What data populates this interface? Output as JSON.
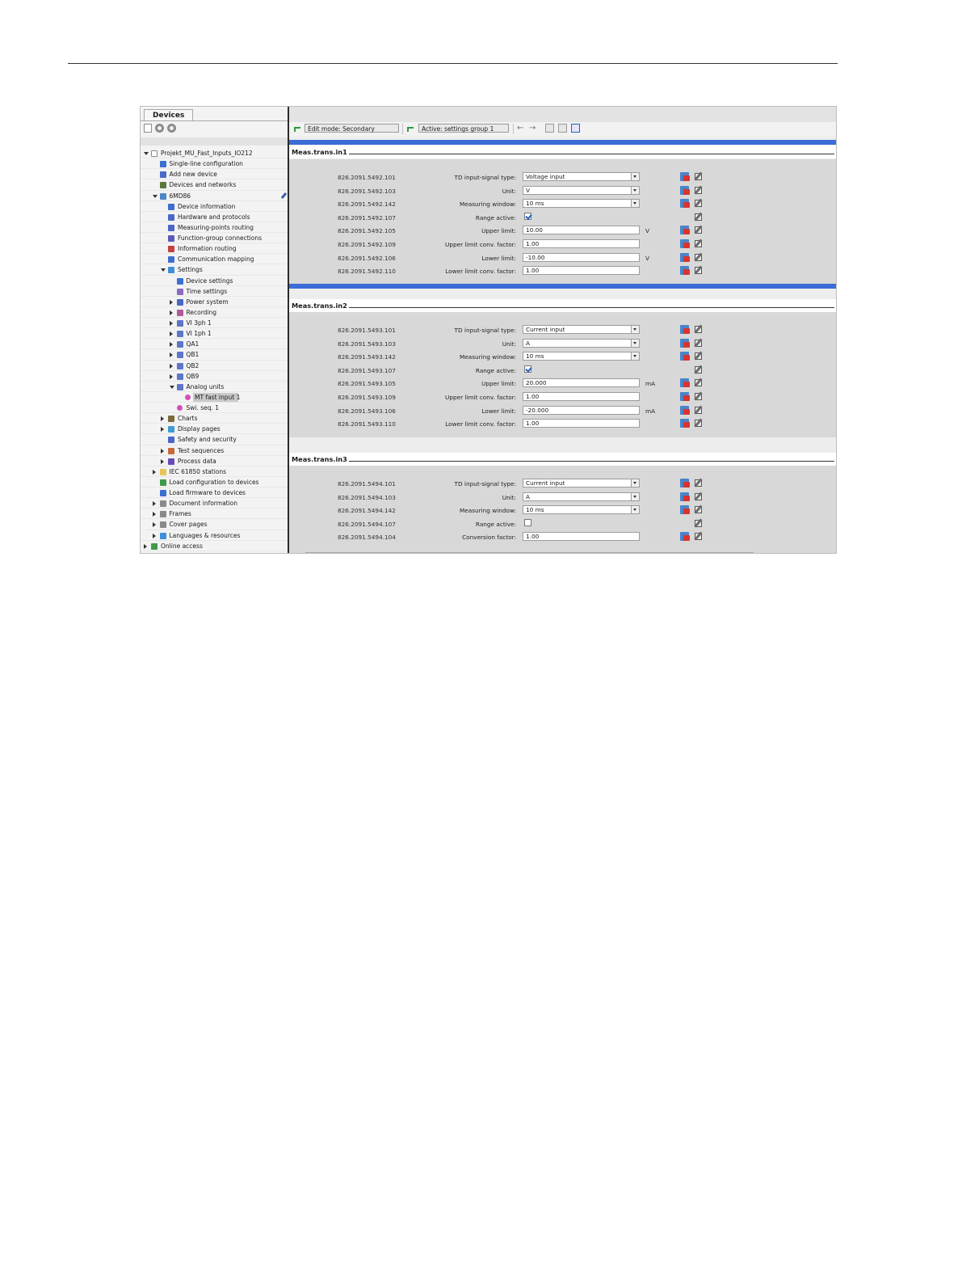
{
  "panel": {
    "tab_label": "Devices"
  },
  "tree": [
    {
      "label": "Projekt_MU_Fast_Inputs_IO212",
      "level": 0,
      "toggle": "open",
      "icon": "project-icon",
      "color": "#ffffff"
    },
    {
      "label": "Single-line configuration",
      "level": 1,
      "toggle": "",
      "icon": "single-line-icon",
      "color": "#3c6fd1"
    },
    {
      "label": "Add new device",
      "level": 1,
      "toggle": "",
      "icon": "add-device-icon",
      "color": "#4b67c7"
    },
    {
      "label": "Devices and networks",
      "level": 1,
      "toggle": "",
      "icon": "network-icon",
      "color": "#5a7a3a"
    },
    {
      "label": "6MD86",
      "level": 1,
      "toggle": "open",
      "icon": "device-icon",
      "color": "#4d86c6",
      "pin": true
    },
    {
      "label": "Device information",
      "level": 2,
      "toggle": "",
      "icon": "info-icon",
      "color": "#3c6fd1"
    },
    {
      "label": "Hardware and protocols",
      "level": 2,
      "toggle": "",
      "icon": "hardware-icon",
      "color": "#4b67c7"
    },
    {
      "label": "Measuring-points routing",
      "level": 2,
      "toggle": "",
      "icon": "routing-icon",
      "color": "#4b67c7"
    },
    {
      "label": "Function-group connections",
      "level": 2,
      "toggle": "",
      "icon": "connection-icon",
      "color": "#5a5ab8"
    },
    {
      "label": "Information routing",
      "level": 2,
      "toggle": "",
      "icon": "matrix-icon",
      "color": "#c74040"
    },
    {
      "label": "Communication mapping",
      "level": 2,
      "toggle": "",
      "icon": "mapping-icon",
      "color": "#3c6fd1"
    },
    {
      "label": "Settings",
      "level": 2,
      "toggle": "open",
      "icon": "settings-icon",
      "color": "#3f8fd6"
    },
    {
      "label": "Device settings",
      "level": 3,
      "toggle": "",
      "icon": "device-settings-icon",
      "color": "#3c6fd1"
    },
    {
      "label": "Time settings",
      "level": 3,
      "toggle": "",
      "icon": "time-settings-icon",
      "color": "#8a6ac4"
    },
    {
      "label": "Power system",
      "level": 3,
      "toggle": "closed",
      "icon": "power-system-icon",
      "color": "#4b67c7"
    },
    {
      "label": "Recording",
      "level": 3,
      "toggle": "closed",
      "icon": "recording-icon",
      "color": "#b05a9a"
    },
    {
      "label": "VI 3ph 1",
      "level": 3,
      "toggle": "closed",
      "icon": "function-group-icon",
      "color": "#5d76c9"
    },
    {
      "label": "VI 1ph 1",
      "level": 3,
      "toggle": "closed",
      "icon": "function-group-icon",
      "color": "#5d76c9"
    },
    {
      "label": "QA1",
      "level": 3,
      "toggle": "closed",
      "icon": "function-group-icon",
      "color": "#5d76c9"
    },
    {
      "label": "QB1",
      "level": 3,
      "toggle": "closed",
      "icon": "function-group-icon",
      "color": "#5d76c9"
    },
    {
      "label": "QB2",
      "level": 3,
      "toggle": "closed",
      "icon": "function-group-icon",
      "color": "#5d76c9"
    },
    {
      "label": "QB9",
      "level": 3,
      "toggle": "closed",
      "icon": "function-group-icon",
      "color": "#5d76c9"
    },
    {
      "label": "Analog units",
      "level": 3,
      "toggle": "open",
      "icon": "function-group-icon",
      "color": "#5d76c9"
    },
    {
      "label": "MT fast input 1",
      "level": 4,
      "toggle": "",
      "icon": "function-icon",
      "color": "#d44fb8",
      "selected": true
    },
    {
      "label": "Swi. seq. 1",
      "level": 3,
      "toggle": "",
      "icon": "function-icon",
      "color": "#d44fb8"
    },
    {
      "label": "Charts",
      "level": 2,
      "toggle": "closed",
      "icon": "charts-icon",
      "color": "#7a6a3a"
    },
    {
      "label": "Display pages",
      "level": 2,
      "toggle": "closed",
      "icon": "display-pages-icon",
      "color": "#3f9ad6"
    },
    {
      "label": "Safety and security",
      "level": 2,
      "toggle": "",
      "icon": "security-icon",
      "color": "#4b67c7"
    },
    {
      "label": "Test sequences",
      "level": 2,
      "toggle": "closed",
      "icon": "test-icon",
      "color": "#c76a3a"
    },
    {
      "label": "Process data",
      "level": 2,
      "toggle": "closed",
      "icon": "process-data-icon",
      "color": "#6a4ab8"
    },
    {
      "label": "IEC 61850 stations",
      "level": 1,
      "toggle": "closed",
      "icon": "folder-icon",
      "color": "#e8c55a"
    },
    {
      "label": "Load configuration to devices",
      "level": 1,
      "toggle": "",
      "icon": "load-config-icon",
      "color": "#3f9a4a"
    },
    {
      "label": "Load firmware to devices",
      "level": 1,
      "toggle": "",
      "icon": "load-firmware-icon",
      "color": "#3c6fd1"
    },
    {
      "label": "Document information",
      "level": 1,
      "toggle": "closed",
      "icon": "document-icon",
      "color": "#8a8a8a"
    },
    {
      "label": "Frames",
      "level": 1,
      "toggle": "closed",
      "icon": "frames-icon",
      "color": "#8a8a8a"
    },
    {
      "label": "Cover pages",
      "level": 1,
      "toggle": "closed",
      "icon": "cover-pages-icon",
      "color": "#8a8a8a"
    },
    {
      "label": "Languages & resources",
      "level": 1,
      "toggle": "closed",
      "icon": "languages-icon",
      "color": "#3f8fd6"
    },
    {
      "label": "Online access",
      "level": 0,
      "toggle": "closed",
      "icon": "online-access-icon",
      "color": "#3f9a4a"
    }
  ],
  "toolbar": {
    "edit_mode": "Edit mode: Secondary",
    "active_group": "Active: settings group 1"
  },
  "sections": [
    {
      "title": "Meas.trans.in1",
      "rows": [
        {
          "id": "826.2091.5492.101",
          "label": "TD input-signal type:",
          "kind": "select",
          "value": "Voltage input",
          "unit": "",
          "reset": true
        },
        {
          "id": "826.2091.5492.103",
          "label": "Unit:",
          "kind": "select",
          "value": "V",
          "unit": "",
          "reset": true
        },
        {
          "id": "826.2091.5492.142",
          "label": "Measuring window:",
          "kind": "select",
          "value": "10 ms",
          "unit": "",
          "reset": true
        },
        {
          "id": "826.2091.5492.107",
          "label": "Range active:",
          "kind": "checkbox",
          "checked": true,
          "unit": "",
          "reset": false
        },
        {
          "id": "826.2091.5492.105",
          "label": "Upper limit:",
          "kind": "text",
          "value": "10.00",
          "unit": "V",
          "reset": true
        },
        {
          "id": "826.2091.5492.109",
          "label": "Upper limit conv. factor:",
          "kind": "text",
          "value": "1.00",
          "unit": "",
          "reset": true
        },
        {
          "id": "826.2091.5492.106",
          "label": "Lower limit:",
          "kind": "text",
          "value": "-10.00",
          "unit": "V",
          "reset": true
        },
        {
          "id": "826.2091.5492.110",
          "label": "Lower limit conv. factor:",
          "kind": "text",
          "value": "1.00",
          "unit": "",
          "reset": true
        }
      ]
    },
    {
      "title": "Meas.trans.in2",
      "rows": [
        {
          "id": "826.2091.5493.101",
          "label": "TD input-signal type:",
          "kind": "select",
          "value": "Current input",
          "unit": "",
          "reset": true
        },
        {
          "id": "826.2091.5493.103",
          "label": "Unit:",
          "kind": "select",
          "value": "A",
          "unit": "",
          "reset": true
        },
        {
          "id": "826.2091.5493.142",
          "label": "Measuring window:",
          "kind": "select",
          "value": "10 ms",
          "unit": "",
          "reset": true
        },
        {
          "id": "826.2091.5493.107",
          "label": "Range active:",
          "kind": "checkbox",
          "checked": true,
          "unit": "",
          "reset": false
        },
        {
          "id": "826.2091.5493.105",
          "label": "Upper limit:",
          "kind": "text",
          "value": "20.000",
          "unit": "mA",
          "reset": true
        },
        {
          "id": "826.2091.5493.109",
          "label": "Upper limit conv. factor:",
          "kind": "text",
          "value": "1.00",
          "unit": "",
          "reset": true
        },
        {
          "id": "826.2091.5493.106",
          "label": "Lower limit:",
          "kind": "text",
          "value": "-20.000",
          "unit": "mA",
          "reset": true
        },
        {
          "id": "826.2091.5493.110",
          "label": "Lower limit conv. factor:",
          "kind": "text",
          "value": "1.00",
          "unit": "",
          "reset": true
        }
      ]
    },
    {
      "title": "Meas.trans.in3",
      "rows": [
        {
          "id": "826.2091.5494.101",
          "label": "TD input-signal type:",
          "kind": "select",
          "value": "Current input",
          "unit": "",
          "reset": true
        },
        {
          "id": "826.2091.5494.103",
          "label": "Unit:",
          "kind": "select",
          "value": "A",
          "unit": "",
          "reset": true
        },
        {
          "id": "826.2091.5494.142",
          "label": "Measuring window:",
          "kind": "select",
          "value": "10 ms",
          "unit": "",
          "reset": true
        },
        {
          "id": "826.2091.5494.107",
          "label": "Range active:",
          "kind": "checkbox",
          "checked": false,
          "unit": "",
          "reset": false
        },
        {
          "id": "826.2091.5494.104",
          "label": "Conversion factor:",
          "kind": "text",
          "value": "1.00",
          "unit": "",
          "reset": true
        }
      ]
    }
  ],
  "colors": {
    "section_bar": "#3b6cd7",
    "panel_bg": "#f3f3f3",
    "form_bg": "#d8d8d8"
  }
}
